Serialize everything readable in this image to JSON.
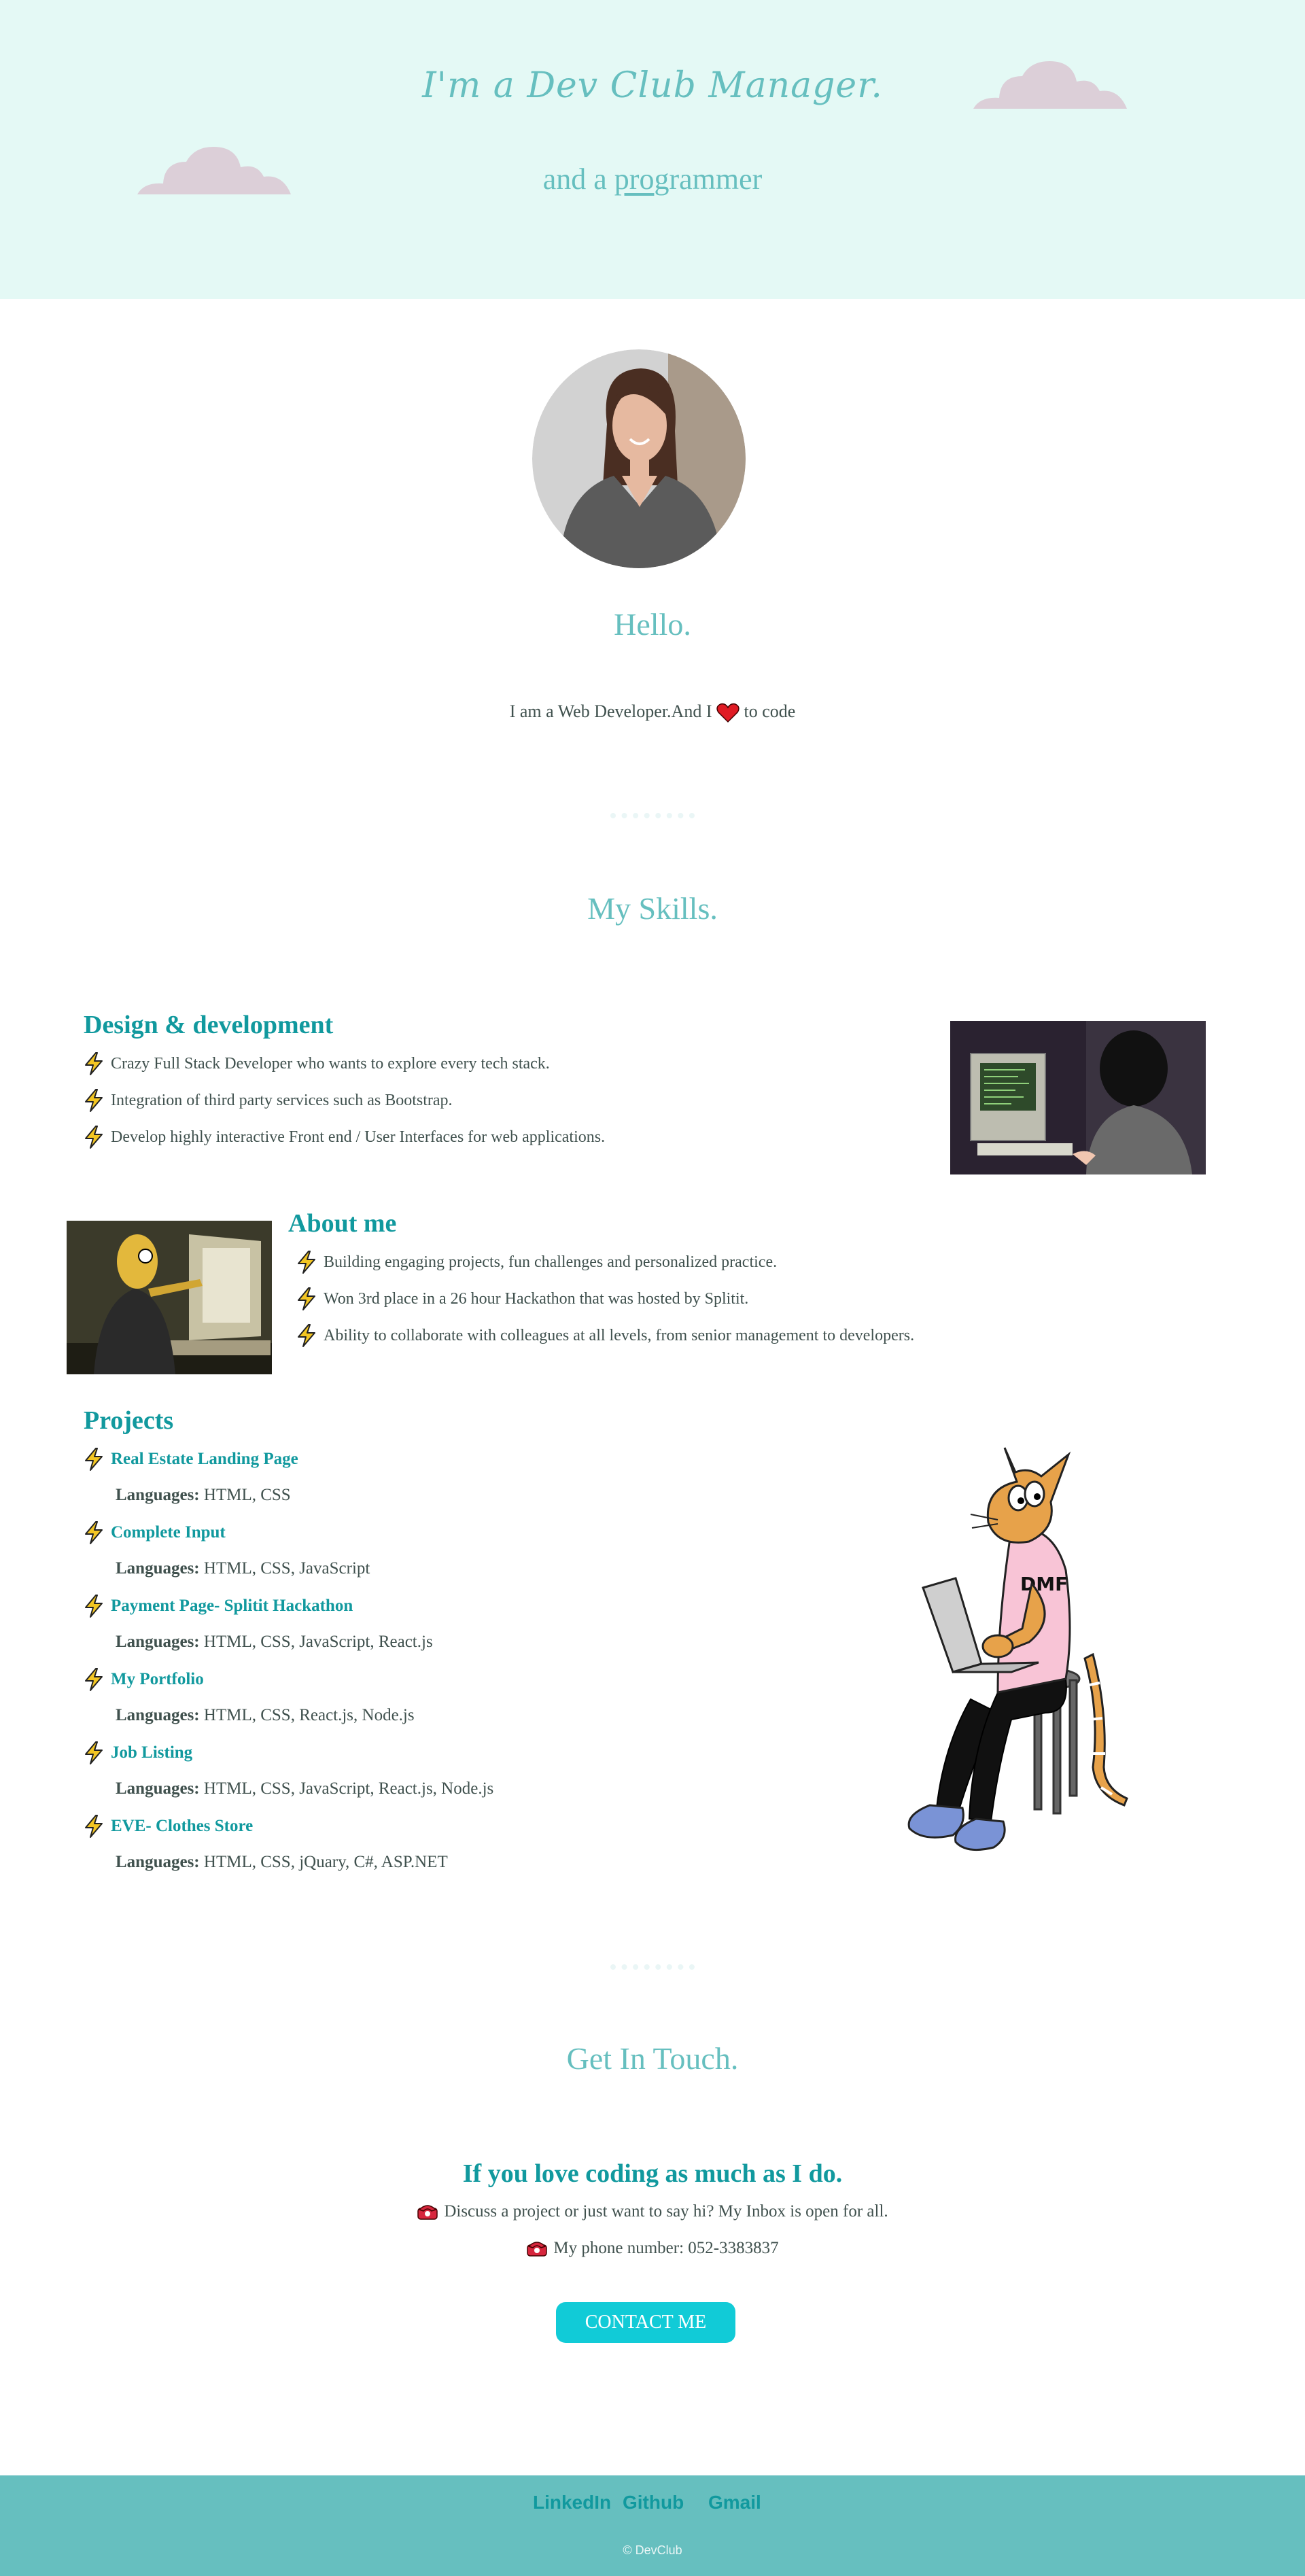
{
  "hero": {
    "title": "I'm a Dev Club Manager.",
    "subtitle_pre": "and a ",
    "subtitle_underlined": "pro",
    "subtitle_post": "grammer"
  },
  "intro": {
    "greeting": "Hello.",
    "text_before": "I am a Web Developer.And I",
    "text_after": "to code"
  },
  "skills": {
    "title": "My Skills.",
    "design": {
      "heading": "Design & development",
      "items": [
        "Crazy Full Stack Developer who wants to explore every tech stack.",
        "Integration of third party services such as Bootstrap.",
        "Develop highly interactive Front end / User Interfaces for web applications."
      ]
    },
    "about": {
      "heading": "About me",
      "items": [
        "Building engaging projects, fun challenges and personalized practice.",
        "Won 3rd place in a 26 hour Hackathon that was hosted by Splitit.",
        "Ability to collaborate with colleagues at all levels, from senior management to developers."
      ]
    },
    "projects": {
      "heading": "Projects",
      "languages_label": "Languages:",
      "items": [
        {
          "name": "Real Estate Landing Page",
          "languages": "HTML, CSS"
        },
        {
          "name": "Complete Input",
          "languages": "HTML, CSS, JavaScript"
        },
        {
          "name": "Payment Page- Splitit Hackathon",
          "languages": "HTML, CSS, JavaScript, React.js"
        },
        {
          "name": "My Portfolio",
          "languages": "HTML, CSS, React.js, Node.js"
        },
        {
          "name": "Job Listing",
          "languages": "HTML, CSS, JavaScript, React.js, Node.js"
        },
        {
          "name": "EVE- Clothes Store",
          "languages": "HTML, CSS, jQuary, C#, ASP.NET"
        }
      ]
    }
  },
  "contact": {
    "title": "Get In Touch.",
    "heading": "If you love coding as much as I do.",
    "line1": "Discuss a project or just want to say hi? My Inbox is open for all.",
    "line2": "My phone number: 052-3383837",
    "button": "CONTACT ME"
  },
  "footer": {
    "links": [
      "LinkedIn",
      "Github",
      "Gmail"
    ],
    "copyright": "© DevClub"
  },
  "colors": {
    "hero_bg": "#e4f9f5",
    "accent_light": "#66bfbf",
    "accent_dark": "#11999e",
    "button": "#11cbd7",
    "text": "#40514e",
    "cloud": "#dccfd8"
  }
}
